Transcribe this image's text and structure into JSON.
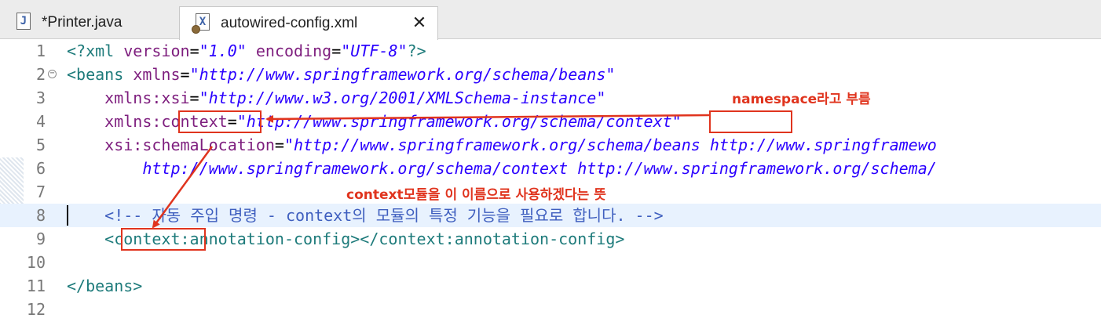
{
  "tabs": [
    {
      "icon": "java-file-icon",
      "icon_letter": "J",
      "label": "*Printer.java"
    },
    {
      "icon": "xml-file-icon",
      "icon_letter": "X",
      "label": "autowired-config.xml",
      "close_glyph": "✕"
    }
  ],
  "editor": {
    "current_line": 8,
    "lines": [
      {
        "num": "1"
      },
      {
        "num": "2"
      },
      {
        "num": "3"
      },
      {
        "num": "4"
      },
      {
        "num": "5"
      },
      {
        "num": "6"
      },
      {
        "num": "7"
      },
      {
        "num": "8"
      },
      {
        "num": "9"
      },
      {
        "num": "10"
      },
      {
        "num": "11"
      },
      {
        "num": "12"
      }
    ],
    "code": {
      "l1": {
        "open": "<?",
        "tag": "xml",
        "sp1": " ",
        "a1": "version",
        "eq1": "=",
        "v1": "\"1.0\"",
        "sp2": " ",
        "a2": "encoding",
        "eq2": "=",
        "v2": "\"UTF-8\"",
        "close": "?>"
      },
      "l2": {
        "open": "<",
        "tag": "beans",
        "sp": " ",
        "a": "xmlns",
        "eq": "=",
        "v": "\"http://www.springframework.org/schema/beans\""
      },
      "l3": {
        "indent": "    ",
        "a": "xmlns:xsi",
        "eq": "=",
        "v": "\"http://www.w3.org/2001/XMLSchema-instance\""
      },
      "l4": {
        "indent": "    ",
        "a": "xmlns:context",
        "eq": "=",
        "v": "\"http://www.springframework.org/schema/context\""
      },
      "l5": {
        "indent": "    ",
        "a": "xsi:schemaLocation",
        "eq": "=",
        "v": "\"http://www.springframework.org/schema/beans http://www.springframewo"
      },
      "l6": {
        "indent": "        ",
        "v": "http://www.springframework.org/schema/context http://www.springframework.org/schema/"
      },
      "l8": {
        "indent": "    ",
        "c": "<!-- 자동 주입 명령 - context의 모듈의 특정 기능을 필요로 합니다. -->"
      },
      "l9": {
        "indent": "    ",
        "t1": "<context:annotation-config></context:annotation-config>"
      },
      "l11": {
        "t": "</beans>"
      }
    }
  },
  "annotations": {
    "namespace_note": "namespace라고 부름",
    "context_note": "context모듈을 이 이름으로 사용하겠다는 뜻"
  },
  "colors": {
    "annotation": "#e0341e",
    "tag": "#1e7b7b",
    "attribute": "#7e1e7e",
    "value": "#2a00ff",
    "comment": "#3f5fbf",
    "current_line": "#e8f2fe"
  }
}
